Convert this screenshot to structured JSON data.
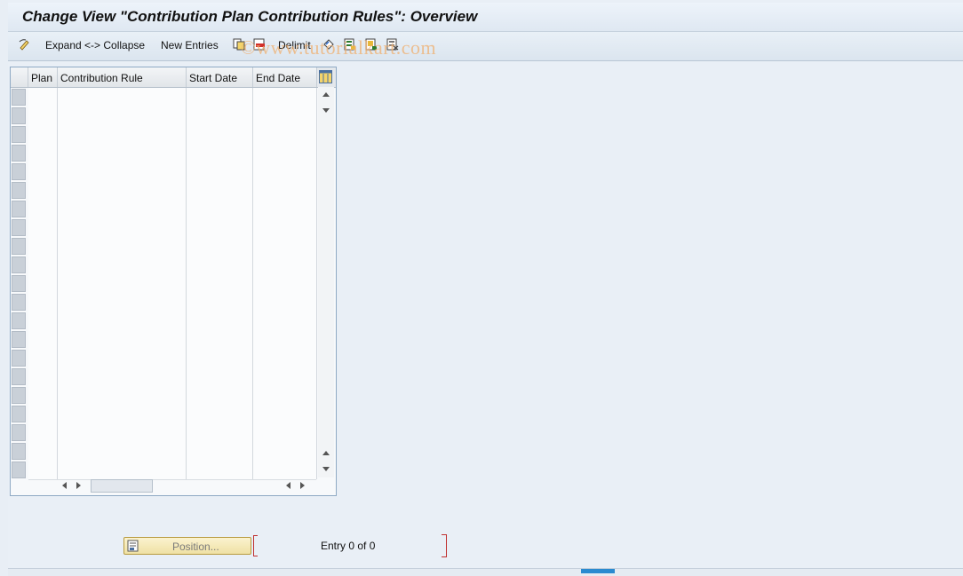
{
  "title": "Change View \"Contribution Plan Contribution Rules\": Overview",
  "toolbar": {
    "expand_collapse_label": "Expand <-> Collapse",
    "new_entries_label": "New Entries",
    "delimit_label": "Delimit"
  },
  "watermark": "©www.tutorialkart.com",
  "table": {
    "columns": [
      "Plan",
      "Contribution Rule",
      "Start Date",
      "End Date"
    ],
    "rows": []
  },
  "footer": {
    "position_button_label": "Position...",
    "entry_text": "Entry 0 of 0"
  }
}
